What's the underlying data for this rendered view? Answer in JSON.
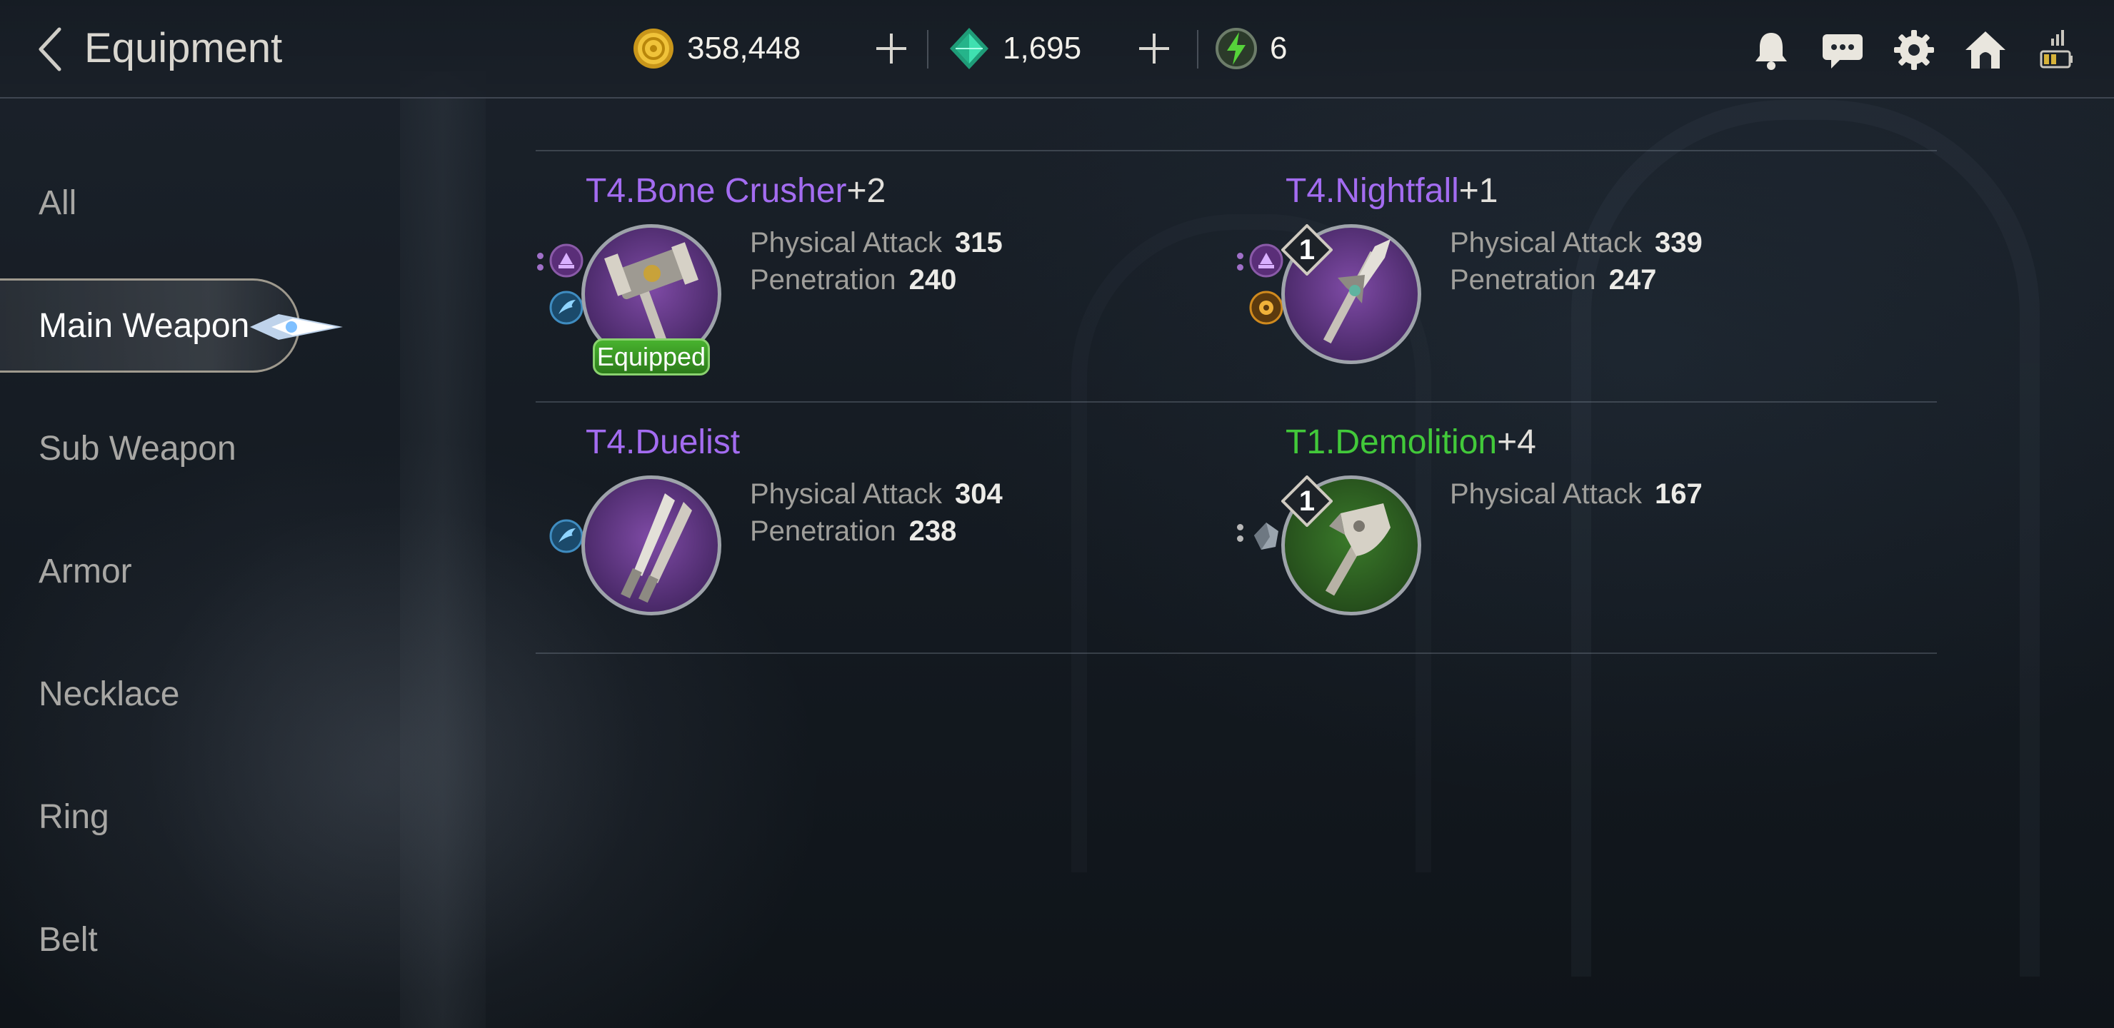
{
  "header": {
    "title": "Equipment",
    "currencies": [
      {
        "name": "gold",
        "icon": "gold-coin-icon",
        "value": "358,448",
        "color": "#e0b020"
      },
      {
        "name": "gem",
        "icon": "green-gem-icon",
        "value": "1,695",
        "color": "#2fc79a"
      },
      {
        "name": "energy",
        "icon": "energy-emblem-icon",
        "value": "6",
        "color": "#56d33a"
      }
    ],
    "top_icons": [
      "bell-icon",
      "chat-icon",
      "gear-icon",
      "home-icon",
      "signal-battery-icon"
    ]
  },
  "sidebar": {
    "items": [
      {
        "label": "All"
      },
      {
        "label": "Main Weapon",
        "active": true
      },
      {
        "label": "Sub Weapon"
      },
      {
        "label": "Armor"
      },
      {
        "label": "Necklace"
      },
      {
        "label": "Ring"
      },
      {
        "label": "Belt"
      }
    ]
  },
  "items": [
    {
      "tier_name": "T4.Bone Crusher",
      "plus": "+2",
      "grade_color": "#a36cf0",
      "icon": "warhammer-icon",
      "equipped_label": "Equipped",
      "enhance_level": "",
      "stats": [
        {
          "label": "Physical Attack",
          "value": "315"
        },
        {
          "label": "Penetration",
          "value": "240"
        }
      ]
    },
    {
      "tier_name": "T4.Nightfall",
      "plus": "+1",
      "grade_color": "#a36cf0",
      "icon": "spear-icon",
      "equipped_label": "",
      "enhance_level": "1",
      "stats": [
        {
          "label": "Physical Attack",
          "value": "339"
        },
        {
          "label": "Penetration",
          "value": "247"
        }
      ]
    },
    {
      "tier_name": "T4.Duelist",
      "plus": "",
      "grade_color": "#a36cf0",
      "icon": "twin-blades-icon",
      "equipped_label": "",
      "enhance_level": "",
      "stats": [
        {
          "label": "Physical Attack",
          "value": "304"
        },
        {
          "label": "Penetration",
          "value": "238"
        }
      ]
    },
    {
      "tier_name": "T1.Demolition",
      "plus": "+4",
      "grade_color": "#42c93a",
      "icon": "axe-icon",
      "equipped_label": "",
      "enhance_level": "1",
      "stats": [
        {
          "label": "Physical Attack",
          "value": "167"
        }
      ]
    }
  ]
}
